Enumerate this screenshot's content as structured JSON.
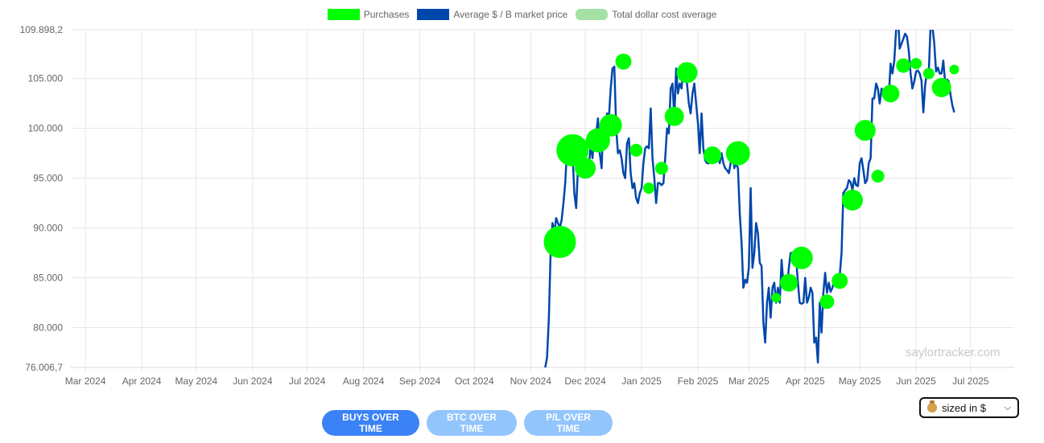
{
  "legend": {
    "purchases": "Purchases",
    "price": "Average $ / B market price",
    "avg": "Total dollar cost average"
  },
  "watermark": "saylortracker.com",
  "buttons": {
    "buys": "BUYS OVER TIME",
    "btc": "BTC OVER TIME",
    "pl": "P/L OVER TIME"
  },
  "sizing_select": {
    "value": "sized in $"
  },
  "colors": {
    "purchases": "#00ff00",
    "price": "#0047ab",
    "avg": "#8ed88e"
  },
  "chart_data": {
    "type": "line",
    "legend_position": "top",
    "grid": true,
    "x_range": [
      "2024-02-22",
      "2025-07-25"
    ],
    "ylim": [
      76006.7,
      109898.2
    ],
    "y_ticks": [
      {
        "value": 76006.7,
        "label": "76.006,7"
      },
      {
        "value": 80000,
        "label": "80.000"
      },
      {
        "value": 85000,
        "label": "85.000"
      },
      {
        "value": 90000,
        "label": "90.000"
      },
      {
        "value": 95000,
        "label": "95.000"
      },
      {
        "value": 100000,
        "label": "100.000"
      },
      {
        "value": 105000,
        "label": "105.000"
      },
      {
        "value": 109898.2,
        "label": "109.898,2"
      }
    ],
    "x_ticks": [
      {
        "date": "2024-03-01",
        "label": "Mar 2024"
      },
      {
        "date": "2024-04-01",
        "label": "Apr 2024"
      },
      {
        "date": "2024-05-01",
        "label": "May 2024"
      },
      {
        "date": "2024-06-01",
        "label": "Jun 2024"
      },
      {
        "date": "2024-07-01",
        "label": "Jul 2024"
      },
      {
        "date": "2024-08-01",
        "label": "Aug 2024"
      },
      {
        "date": "2024-09-01",
        "label": "Sep 2024"
      },
      {
        "date": "2024-10-01",
        "label": "Oct 2024"
      },
      {
        "date": "2024-11-01",
        "label": "Nov 2024"
      },
      {
        "date": "2024-12-01",
        "label": "Dec 2024"
      },
      {
        "date": "2025-01-01",
        "label": "Jan 2025"
      },
      {
        "date": "2025-02-01",
        "label": "Feb 2025"
      },
      {
        "date": "2025-03-01",
        "label": "Mar 2025"
      },
      {
        "date": "2025-04-01",
        "label": "Apr 2025"
      },
      {
        "date": "2025-05-01",
        "label": "May 2025"
      },
      {
        "date": "2025-06-01",
        "label": "Jun 2025"
      },
      {
        "date": "2025-07-01",
        "label": "Jul 2025"
      }
    ],
    "price_series": [
      [
        "2024-11-09",
        76000
      ],
      [
        "2024-11-10",
        77000
      ],
      [
        "2024-11-11",
        81000
      ],
      [
        "2024-11-12",
        88000
      ],
      [
        "2024-11-13",
        90500
      ],
      [
        "2024-11-14",
        89500
      ],
      [
        "2024-11-15",
        91000
      ],
      [
        "2024-11-16",
        90500
      ],
      [
        "2024-11-17",
        90000
      ],
      [
        "2024-11-18",
        90800
      ],
      [
        "2024-11-19",
        92500
      ],
      [
        "2024-11-20",
        94500
      ],
      [
        "2024-11-21",
        98000
      ],
      [
        "2024-11-22",
        98500
      ],
      [
        "2024-11-23",
        97800
      ],
      [
        "2024-11-24",
        97500
      ],
      [
        "2024-11-25",
        93500
      ],
      [
        "2024-11-26",
        92000
      ],
      [
        "2024-11-27",
        96000
      ],
      [
        "2024-11-28",
        95500
      ],
      [
        "2024-11-29",
        97500
      ],
      [
        "2024-11-30",
        96500
      ],
      [
        "2024-12-01",
        97000
      ],
      [
        "2024-12-02",
        96500
      ],
      [
        "2024-12-03",
        96000
      ],
      [
        "2024-12-04",
        98500
      ],
      [
        "2024-12-05",
        97000
      ],
      [
        "2024-12-06",
        99800
      ],
      [
        "2024-12-07",
        99500
      ],
      [
        "2024-12-08",
        101000
      ],
      [
        "2024-12-09",
        97500
      ],
      [
        "2024-12-10",
        96000
      ],
      [
        "2024-12-11",
        100500
      ],
      [
        "2024-12-12",
        100000
      ],
      [
        "2024-12-13",
        101500
      ],
      [
        "2024-12-14",
        101000
      ],
      [
        "2024-12-15",
        104000
      ],
      [
        "2024-12-16",
        106000
      ],
      [
        "2024-12-17",
        106200
      ],
      [
        "2024-12-18",
        100000
      ],
      [
        "2024-12-19",
        97500
      ],
      [
        "2024-12-20",
        97800
      ],
      [
        "2024-12-21",
        97000
      ],
      [
        "2024-12-22",
        95500
      ],
      [
        "2024-12-23",
        95000
      ],
      [
        "2024-12-24",
        98500
      ],
      [
        "2024-12-25",
        99000
      ],
      [
        "2024-12-26",
        95500
      ],
      [
        "2024-12-27",
        94000
      ],
      [
        "2024-12-28",
        94500
      ],
      [
        "2024-12-29",
        93000
      ],
      [
        "2024-12-30",
        92500
      ],
      [
        "2024-12-31",
        93500
      ],
      [
        "2025-01-01",
        94000
      ],
      [
        "2025-01-02",
        96500
      ],
      [
        "2025-01-03",
        98000
      ],
      [
        "2025-01-04",
        98200
      ],
      [
        "2025-01-05",
        98000
      ],
      [
        "2025-01-06",
        102000
      ],
      [
        "2025-01-07",
        97000
      ],
      [
        "2025-01-08",
        95000
      ],
      [
        "2025-01-09",
        92500
      ],
      [
        "2025-01-10",
        94500
      ],
      [
        "2025-01-11",
        94500
      ],
      [
        "2025-01-12",
        94300
      ],
      [
        "2025-01-13",
        94500
      ],
      [
        "2025-01-14",
        97000
      ],
      [
        "2025-01-15",
        100000
      ],
      [
        "2025-01-16",
        99500
      ],
      [
        "2025-01-17",
        104000
      ],
      [
        "2025-01-18",
        104500
      ],
      [
        "2025-01-19",
        101000
      ],
      [
        "2025-01-20",
        106000
      ],
      [
        "2025-01-21",
        103500
      ],
      [
        "2025-01-22",
        104500
      ],
      [
        "2025-01-23",
        104000
      ],
      [
        "2025-01-24",
        106500
      ],
      [
        "2025-01-25",
        105000
      ],
      [
        "2025-01-26",
        104500
      ],
      [
        "2025-01-27",
        102500
      ],
      [
        "2025-01-28",
        101500
      ],
      [
        "2025-01-29",
        103500
      ],
      [
        "2025-01-30",
        104500
      ],
      [
        "2025-01-31",
        102500
      ],
      [
        "2025-02-01",
        100500
      ],
      [
        "2025-02-02",
        97500
      ],
      [
        "2025-02-03",
        101500
      ],
      [
        "2025-02-04",
        98000
      ],
      [
        "2025-02-05",
        96800
      ],
      [
        "2025-02-06",
        96500
      ],
      [
        "2025-02-07",
        96500
      ],
      [
        "2025-02-08",
        96800
      ],
      [
        "2025-02-09",
        96500
      ],
      [
        "2025-02-10",
        97500
      ],
      [
        "2025-02-11",
        97000
      ],
      [
        "2025-02-12",
        97500
      ],
      [
        "2025-02-13",
        96500
      ],
      [
        "2025-02-14",
        97500
      ],
      [
        "2025-02-15",
        96500
      ],
      [
        "2025-02-16",
        96000
      ],
      [
        "2025-02-17",
        95800
      ],
      [
        "2025-02-18",
        95500
      ],
      [
        "2025-02-19",
        96500
      ],
      [
        "2025-02-20",
        97800
      ],
      [
        "2025-02-21",
        96000
      ],
      [
        "2025-02-22",
        96500
      ],
      [
        "2025-02-23",
        96000
      ],
      [
        "2025-02-24",
        91500
      ],
      [
        "2025-02-25",
        88500
      ],
      [
        "2025-02-26",
        84000
      ],
      [
        "2025-02-27",
        84800
      ],
      [
        "2025-02-28",
        84500
      ],
      [
        "2025-03-01",
        86000
      ],
      [
        "2025-03-02",
        94000
      ],
      [
        "2025-03-03",
        86000
      ],
      [
        "2025-03-04",
        87500
      ],
      [
        "2025-03-05",
        90500
      ],
      [
        "2025-03-06",
        89500
      ],
      [
        "2025-03-07",
        86500
      ],
      [
        "2025-03-08",
        86200
      ],
      [
        "2025-03-09",
        80500
      ],
      [
        "2025-03-10",
        78500
      ],
      [
        "2025-03-11",
        82500
      ],
      [
        "2025-03-12",
        84000
      ],
      [
        "2025-03-13",
        81000
      ],
      [
        "2025-03-14",
        84000
      ],
      [
        "2025-03-15",
        84500
      ],
      [
        "2025-03-16",
        82500
      ],
      [
        "2025-03-17",
        84000
      ],
      [
        "2025-03-18",
        82500
      ],
      [
        "2025-03-19",
        86800
      ],
      [
        "2025-03-20",
        84500
      ],
      [
        "2025-03-21",
        84200
      ],
      [
        "2025-03-22",
        84000
      ],
      [
        "2025-03-23",
        86000
      ],
      [
        "2025-03-24",
        87500
      ],
      [
        "2025-03-25",
        87500
      ],
      [
        "2025-03-26",
        86800
      ],
      [
        "2025-03-27",
        87000
      ],
      [
        "2025-03-28",
        84500
      ],
      [
        "2025-03-29",
        82500
      ],
      [
        "2025-03-30",
        82400
      ],
      [
        "2025-03-31",
        82500
      ],
      [
        "2025-04-01",
        85000
      ],
      [
        "2025-04-02",
        82500
      ],
      [
        "2025-04-03",
        83000
      ],
      [
        "2025-04-04",
        84000
      ],
      [
        "2025-04-05",
        83500
      ],
      [
        "2025-04-06",
        78500
      ],
      [
        "2025-04-07",
        79000
      ],
      [
        "2025-04-08",
        76500
      ],
      [
        "2025-04-09",
        82500
      ],
      [
        "2025-04-10",
        79500
      ],
      [
        "2025-04-11",
        83500
      ],
      [
        "2025-04-12",
        85500
      ],
      [
        "2025-04-13",
        83500
      ],
      [
        "2025-04-14",
        84500
      ],
      [
        "2025-04-15",
        83600
      ],
      [
        "2025-04-16",
        84000
      ],
      [
        "2025-04-17",
        84800
      ],
      [
        "2025-04-18",
        84500
      ],
      [
        "2025-04-19",
        85000
      ],
      [
        "2025-04-20",
        85200
      ],
      [
        "2025-04-21",
        87500
      ],
      [
        "2025-04-22",
        93500
      ],
      [
        "2025-04-23",
        93800
      ],
      [
        "2025-04-24",
        94000
      ],
      [
        "2025-04-25",
        94800
      ],
      [
        "2025-04-26",
        94600
      ],
      [
        "2025-04-27",
        93800
      ],
      [
        "2025-04-28",
        95000
      ],
      [
        "2025-04-29",
        94300
      ],
      [
        "2025-04-30",
        94200
      ],
      [
        "2025-05-01",
        96500
      ],
      [
        "2025-05-02",
        97000
      ],
      [
        "2025-05-03",
        95800
      ],
      [
        "2025-05-04",
        94500
      ],
      [
        "2025-05-05",
        94800
      ],
      [
        "2025-05-06",
        96500
      ],
      [
        "2025-05-07",
        97000
      ],
      [
        "2025-05-08",
        103000
      ],
      [
        "2025-05-09",
        103000
      ],
      [
        "2025-05-10",
        104500
      ],
      [
        "2025-05-11",
        104000
      ],
      [
        "2025-05-12",
        102500
      ],
      [
        "2025-05-13",
        104000
      ],
      [
        "2025-05-14",
        103500
      ],
      [
        "2025-05-15",
        103800
      ],
      [
        "2025-05-16",
        103500
      ],
      [
        "2025-05-17",
        103200
      ],
      [
        "2025-05-18",
        106500
      ],
      [
        "2025-05-19",
        105500
      ],
      [
        "2025-05-20",
        106800
      ],
      [
        "2025-05-21",
        109800
      ],
      [
        "2025-05-22",
        111500
      ],
      [
        "2025-05-23",
        108000
      ],
      [
        "2025-05-24",
        108500
      ],
      [
        "2025-05-25",
        109000
      ],
      [
        "2025-05-26",
        109500
      ],
      [
        "2025-05-27",
        109200
      ],
      [
        "2025-05-28",
        107800
      ],
      [
        "2025-05-29",
        105500
      ],
      [
        "2025-05-30",
        104000
      ],
      [
        "2025-05-31",
        104700
      ],
      [
        "2025-06-01",
        105700
      ],
      [
        "2025-06-02",
        105800
      ],
      [
        "2025-06-03",
        105500
      ],
      [
        "2025-06-04",
        104800
      ],
      [
        "2025-06-05",
        101600
      ],
      [
        "2025-06-06",
        104300
      ],
      [
        "2025-06-07",
        105700
      ],
      [
        "2025-06-08",
        105700
      ],
      [
        "2025-06-09",
        110300
      ],
      [
        "2025-06-10",
        110200
      ],
      [
        "2025-06-11",
        108600
      ],
      [
        "2025-06-12",
        105700
      ],
      [
        "2025-06-13",
        106100
      ],
      [
        "2025-06-14",
        105500
      ],
      [
        "2025-06-15",
        105500
      ],
      [
        "2025-06-16",
        106800
      ],
      [
        "2025-06-17",
        104600
      ],
      [
        "2025-06-18",
        104900
      ],
      [
        "2025-06-19",
        104700
      ],
      [
        "2025-06-20",
        103300
      ],
      [
        "2025-06-21",
        102300
      ],
      [
        "2025-06-22",
        101600
      ]
    ],
    "purchases": [
      {
        "date": "2024-11-17",
        "price": 88600,
        "r": 20
      },
      {
        "date": "2024-11-24",
        "price": 97800,
        "r": 20
      },
      {
        "date": "2024-12-01",
        "price": 96000,
        "r": 13
      },
      {
        "date": "2024-12-08",
        "price": 98800,
        "r": 15
      },
      {
        "date": "2024-12-15",
        "price": 100300,
        "r": 14
      },
      {
        "date": "2024-12-22",
        "price": 106700,
        "r": 10
      },
      {
        "date": "2024-12-29",
        "price": 97800,
        "r": 8
      },
      {
        "date": "2025-01-05",
        "price": 94000,
        "r": 7
      },
      {
        "date": "2025-01-12",
        "price": 96000,
        "r": 8
      },
      {
        "date": "2025-01-19",
        "price": 101200,
        "r": 12
      },
      {
        "date": "2025-01-26",
        "price": 105600,
        "r": 13
      },
      {
        "date": "2025-02-09",
        "price": 97300,
        "r": 11
      },
      {
        "date": "2025-02-23",
        "price": 97500,
        "r": 15
      },
      {
        "date": "2025-03-16",
        "price": 83000,
        "r": 6
      },
      {
        "date": "2025-03-23",
        "price": 84500,
        "r": 11
      },
      {
        "date": "2025-03-30",
        "price": 87000,
        "r": 14
      },
      {
        "date": "2025-04-13",
        "price": 82600,
        "r": 9
      },
      {
        "date": "2025-04-20",
        "price": 84700,
        "r": 10
      },
      {
        "date": "2025-04-27",
        "price": 92800,
        "r": 13
      },
      {
        "date": "2025-05-04",
        "price": 99800,
        "r": 13
      },
      {
        "date": "2025-05-11",
        "price": 95200,
        "r": 8
      },
      {
        "date": "2025-05-18",
        "price": 103500,
        "r": 11
      },
      {
        "date": "2025-05-25",
        "price": 106300,
        "r": 9
      },
      {
        "date": "2025-06-01",
        "price": 106500,
        "r": 7
      },
      {
        "date": "2025-06-08",
        "price": 105500,
        "r": 7
      },
      {
        "date": "2025-06-15",
        "price": 104100,
        "r": 12
      },
      {
        "date": "2025-06-22",
        "price": 105900,
        "r": 6
      }
    ]
  }
}
